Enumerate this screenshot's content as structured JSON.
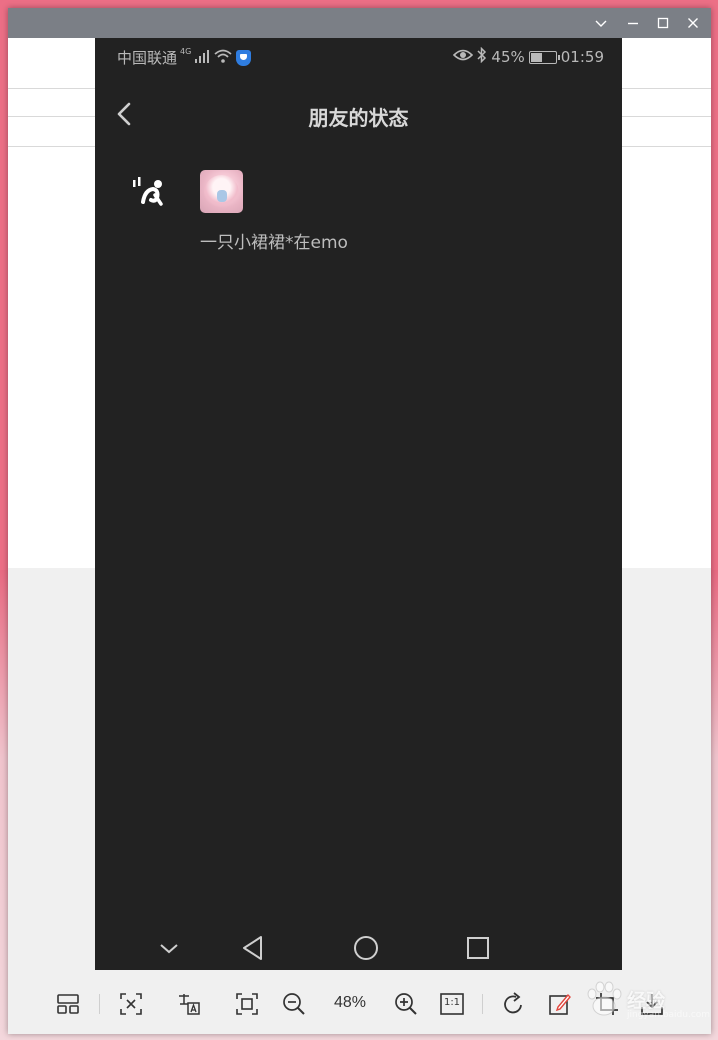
{
  "window": {
    "controls": [
      "chevron-down",
      "minimize",
      "maximize",
      "close"
    ]
  },
  "phone": {
    "status_bar": {
      "carrier": "中国联通",
      "network_type": "4G",
      "battery_percent": "45%",
      "time": "01:59"
    },
    "header": {
      "title": "朋友的状态"
    },
    "friend": {
      "name": "一只小裙裙*在emo",
      "status_icon": "emo-status-icon"
    },
    "system_nav": [
      "collapse",
      "back",
      "home",
      "recents"
    ]
  },
  "viewer_toolbar": {
    "zoom": "48%",
    "actual_size_label": "1:1",
    "buttons": [
      "layout",
      "fit-exit",
      "translate",
      "fit-screen",
      "zoom-out",
      "zoom-in",
      "actual-size",
      "rotate",
      "edit",
      "crop",
      "download"
    ]
  },
  "watermark": {
    "text": "经验",
    "sub": "jingyan.baidu.com"
  },
  "colors": {
    "phone_bg": "#222222",
    "titlebar": "#7b7f86",
    "viewer_bg": "#f0f0f0",
    "accent_blue": "#2f7de0"
  }
}
